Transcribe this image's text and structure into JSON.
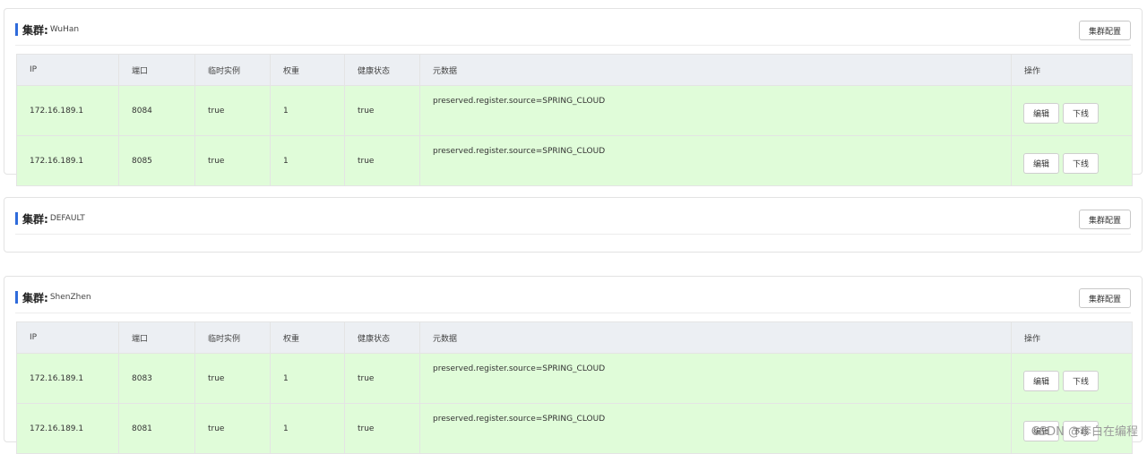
{
  "clusters": [
    {
      "title_label": "集群:",
      "name": "WuHan",
      "config_button": "集群配置",
      "columns": [
        "IP",
        "端口",
        "临时实例",
        "权重",
        "健康状态",
        "元数据",
        "操作"
      ],
      "rows": [
        {
          "ip": "172.16.189.1",
          "port": "8084",
          "ephemeral": "true",
          "weight": "1",
          "healthy": "true",
          "metadata": "preserved.register.source=SPRING_CLOUD",
          "edit": "编辑",
          "offline": "下线"
        },
        {
          "ip": "172.16.189.1",
          "port": "8085",
          "ephemeral": "true",
          "weight": "1",
          "healthy": "true",
          "metadata": "preserved.register.source=SPRING_CLOUD",
          "edit": "编辑",
          "offline": "下线"
        }
      ]
    },
    {
      "title_label": "集群:",
      "name": "DEFAULT",
      "config_button": "集群配置",
      "columns": [],
      "rows": []
    },
    {
      "title_label": "集群:",
      "name": "ShenZhen",
      "config_button": "集群配置",
      "columns": [
        "IP",
        "端口",
        "临时实例",
        "权重",
        "健康状态",
        "元数据",
        "操作"
      ],
      "rows": [
        {
          "ip": "172.16.189.1",
          "port": "8083",
          "ephemeral": "true",
          "weight": "1",
          "healthy": "true",
          "metadata": "preserved.register.source=SPRING_CLOUD",
          "edit": "编辑",
          "offline": "下线"
        },
        {
          "ip": "172.16.189.1",
          "port": "8081",
          "ephemeral": "true",
          "weight": "1",
          "healthy": "true",
          "metadata": "preserved.register.source=SPRING_CLOUD",
          "edit": "编辑",
          "offline": "下线"
        }
      ]
    }
  ],
  "watermark": "CSDN @李白在编程"
}
